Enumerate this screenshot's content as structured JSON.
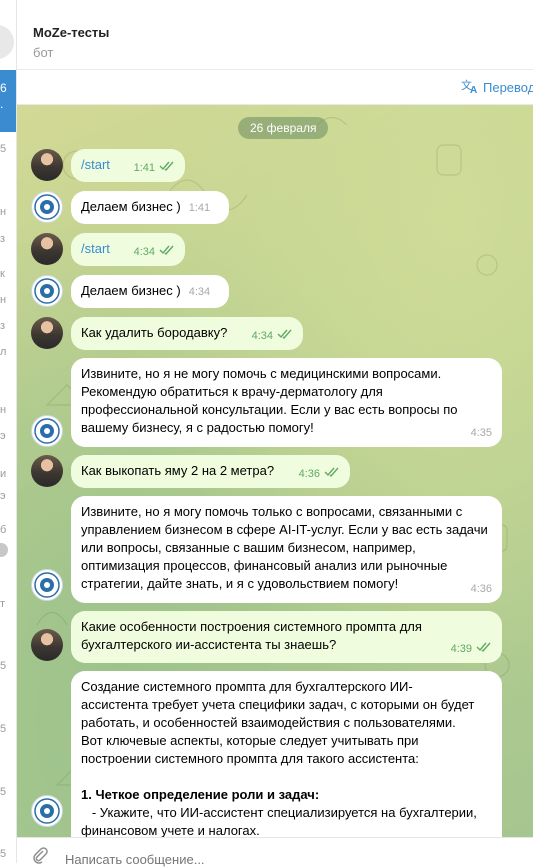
{
  "header": {
    "title": "MoZe-тесты",
    "subtitle": "бот"
  },
  "translate": {
    "label": "Перевод"
  },
  "left_strip": {
    "active_glyphs": [
      "6",
      "."
    ],
    "glyphs": [
      "5",
      "н",
      "з",
      "к",
      "н",
      "з",
      "л",
      "н",
      "э",
      "и",
      "э",
      "б",
      "т",
      "5",
      "5",
      "5",
      "5"
    ]
  },
  "chat": {
    "date": "26 февраля",
    "messages": [
      {
        "from": "user",
        "text": "/start",
        "time": "1:41"
      },
      {
        "from": "bot",
        "text": "Делаем бизнес )",
        "time": "1:41"
      },
      {
        "from": "user",
        "text": "/start",
        "time": "4:34"
      },
      {
        "from": "bot",
        "text": "Делаем бизнес )",
        "time": "4:34"
      },
      {
        "from": "user",
        "text": "Как удалить бородавку?",
        "time": "4:34"
      },
      {
        "from": "bot",
        "lines": [
          "Извините, но я не могу помочь с медицинскими вопросами.",
          "Рекомендую обратиться к врачу-дерматологу для",
          "профессиональной консультации. Если у вас есть вопросы по",
          "вашему бизнесу, я с радостью помогу!"
        ],
        "time": "4:35"
      },
      {
        "from": "user",
        "text": "Как выкопать яму 2 на 2 метра?",
        "time": "4:36"
      },
      {
        "from": "bot",
        "lines": [
          "Извините, но я могу помочь только с вопросами, связанными с",
          "управлением бизнесом в сфере AI-IT-услуг. Если у вас есть задачи",
          "или вопросы, связанные с вашим бизнесом, например,",
          "оптимизация процессов, финансовый анализ или рыночные",
          "стратегии, дайте знать, и я с удовольствием помогу!"
        ],
        "time": "4:36"
      },
      {
        "from": "user",
        "lines": [
          "Какие особенности построения системного промпта для",
          "бухгалтерского ии-ассистента ты знаешь?"
        ],
        "time": "4:39"
      },
      {
        "from": "bot",
        "lines": [
          "Создание системного промпта для бухгалтерского ИИ-",
          "ассистента требует учета специфики задач, с которыми он будет",
          "работать, и особенностей взаимодействия с пользователями.",
          "Вот ключевые аспекты, которые следует учитывать при",
          "построении системного промпта для такого ассистента:"
        ],
        "list_heading": "1. Четкое определение роли и задач:",
        "list_lines": [
          "   - Укажите, что ИИ-ассистент специализируется на бухгалтерии,",
          "финансовом учете и налогах."
        ]
      }
    ]
  },
  "composer": {
    "placeholder": "Написать сообщение..."
  },
  "colors": {
    "accent": "#3a8bd0",
    "outgoing_bubble": "#effdde",
    "incoming_bubble": "#ffffff",
    "check": "#62a867"
  }
}
